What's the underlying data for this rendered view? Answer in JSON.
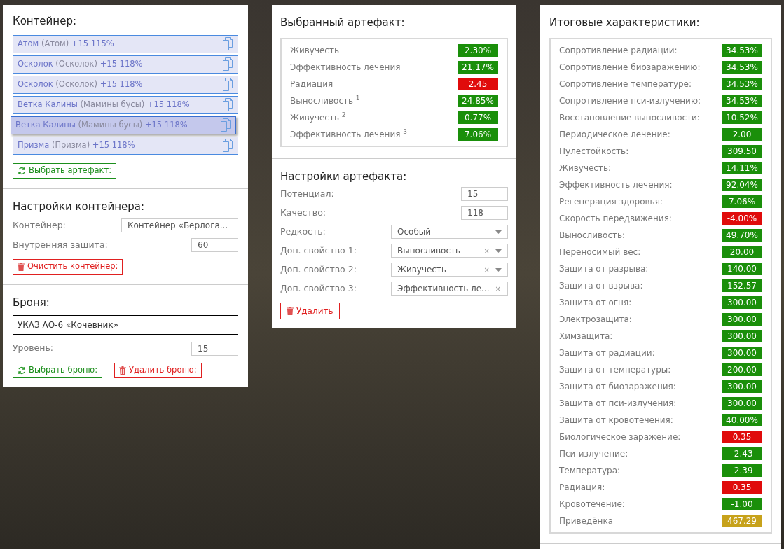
{
  "container": {
    "title": "Контейнер:",
    "items": [
      {
        "name": "Атом",
        "alt": "(Атом)",
        "bonus": "+15 115%",
        "selected": false
      },
      {
        "name": "Осколок",
        "alt": "(Осколок)",
        "bonus": "+15 118%",
        "selected": false
      },
      {
        "name": "Осколок",
        "alt": "(Осколок)",
        "bonus": "+15 118%",
        "selected": false
      },
      {
        "name": "Ветка Калины",
        "alt": "(Мамины бусы)",
        "bonus": "+15 118%",
        "selected": false
      },
      {
        "name": "Ветка Калины",
        "alt": "(Мамины бусы)",
        "bonus": "+15 118%",
        "selected": true
      },
      {
        "name": "Призма",
        "alt": "(Призма)",
        "bonus": "+15 118%",
        "selected": false
      }
    ],
    "choose_button": "Выбрать артефакт:"
  },
  "container_settings": {
    "title": "Настройки контейнера:",
    "fields": [
      {
        "label": "Контейнер:",
        "kind": "select",
        "value": "Контейнер «Берлога..."
      },
      {
        "label": "Внутренняя защита:",
        "kind": "input",
        "value": "60"
      }
    ],
    "clear_button": "Очистить контейнер:"
  },
  "armor": {
    "title": "Броня:",
    "name": "УКАЗ АО-6 «Кочевник»",
    "level_label": "Уровень:",
    "level_value": "15",
    "choose_button": "Выбрать броню:",
    "delete_button": "Удалить броню:"
  },
  "selected_artifact": {
    "title": "Выбранный артефакт:",
    "stats": [
      {
        "label": "Живучесть",
        "value": "2.30%",
        "color": "#1a8f0a"
      },
      {
        "label": "Эффективность лечения",
        "value": "21.17%",
        "color": "#1a8f0a"
      },
      {
        "label": "Радиация",
        "value": "2.45",
        "color": "#e00b0b"
      },
      {
        "label": "Выносливость $^{1}$",
        "value": "24.85%",
        "color": "#1a8f0a"
      },
      {
        "label": "Живучесть $^{2}$",
        "value": "0.77%",
        "color": "#1a8f0a"
      },
      {
        "label": "Эффективность лечения $^{3}$",
        "value": "7.06%",
        "color": "#1a8f0a"
      }
    ]
  },
  "artifact_settings": {
    "title": "Настройки артефакта:",
    "fields": [
      {
        "label": "Потенциал:",
        "kind": "input",
        "value": "15"
      },
      {
        "label": "Качество:",
        "kind": "input",
        "value": "118"
      },
      {
        "label": "Редкость:",
        "kind": "select",
        "value": "Особый"
      },
      {
        "label": "Доп. свойство 1:",
        "kind": "select",
        "value": "Выносливость",
        "clear_glyph": "×"
      },
      {
        "label": "Доп. свойство 2:",
        "kind": "select",
        "value": "Живучесть",
        "clear_glyph": "×"
      },
      {
        "label": "Доп. свойство 3:",
        "kind": "select",
        "value": "Эффективность ле...",
        "clear_glyph": "×"
      }
    ],
    "delete_button": "Удалить"
  },
  "totals": {
    "title": "Итоговые характеристики:",
    "stats": [
      {
        "label": "Сопротивление радиации:",
        "value": "34.53%",
        "color": "#1a8f0a"
      },
      {
        "label": "Сопротивление биозаражению:",
        "value": "34.53%",
        "color": "#1a8f0a"
      },
      {
        "label": "Сопротивление температуре:",
        "value": "34.53%",
        "color": "#1a8f0a"
      },
      {
        "label": "Сопротивление пси-излучению:",
        "value": "34.53%",
        "color": "#1a8f0a"
      },
      {
        "label": "Восстановление выносливости:",
        "value": "10.52%",
        "color": "#1a8f0a"
      },
      {
        "label": "Периодическое лечение:",
        "value": "2.00",
        "color": "#1a8f0a"
      },
      {
        "label": "Пулестойкость:",
        "value": "309.50",
        "color": "#1a8f0a"
      },
      {
        "label": "Живучесть:",
        "value": "14.11%",
        "color": "#1a8f0a"
      },
      {
        "label": "Эффективность лечения:",
        "value": "92.04%",
        "color": "#1a8f0a"
      },
      {
        "label": "Регенерация здоровья:",
        "value": "7.06%",
        "color": "#1a8f0a"
      },
      {
        "label": "Скорость передвижения:",
        "value": "-4.00%",
        "color": "#e00b0b"
      },
      {
        "label": "Выносливость:",
        "value": "49.70%",
        "color": "#1a8f0a"
      },
      {
        "label": "Переносимый вес:",
        "value": "20.00",
        "color": "#1a8f0a"
      },
      {
        "label": "Защита от разрыва:",
        "value": "140.00",
        "color": "#1a8f0a"
      },
      {
        "label": "Защита от взрыва:",
        "value": "152.57",
        "color": "#1a8f0a"
      },
      {
        "label": "Защита от огня:",
        "value": "300.00",
        "color": "#1a8f0a"
      },
      {
        "label": "Электрозащита:",
        "value": "300.00",
        "color": "#1a8f0a"
      },
      {
        "label": "Химзащита:",
        "value": "300.00",
        "color": "#1a8f0a"
      },
      {
        "label": "Защита от радиации:",
        "value": "300.00",
        "color": "#1a8f0a"
      },
      {
        "label": "Защита от температуры:",
        "value": "200.00",
        "color": "#1a8f0a"
      },
      {
        "label": "Защита от биозаражения:",
        "value": "300.00",
        "color": "#1a8f0a"
      },
      {
        "label": "Защита от пси-излучения:",
        "value": "300.00",
        "color": "#1a8f0a"
      },
      {
        "label": "Защита от кровотечения:",
        "value": "40.00%",
        "color": "#1a8f0a"
      },
      {
        "label": "Биологическое заражение:",
        "value": "0.35",
        "color": "#e00b0b"
      },
      {
        "label": "Пси-излучение:",
        "value": "-2.43",
        "color": "#1a8f0a"
      },
      {
        "label": "Температура:",
        "value": "-2.39",
        "color": "#1a8f0a"
      },
      {
        "label": "Радиация:",
        "value": "0.35",
        "color": "#e00b0b"
      },
      {
        "label": "Кровотечение:",
        "value": "-1.00",
        "color": "#1a8f0a"
      },
      {
        "label": "Приведёнка",
        "value": "467.29",
        "color": "#c7a21b"
      }
    ]
  }
}
